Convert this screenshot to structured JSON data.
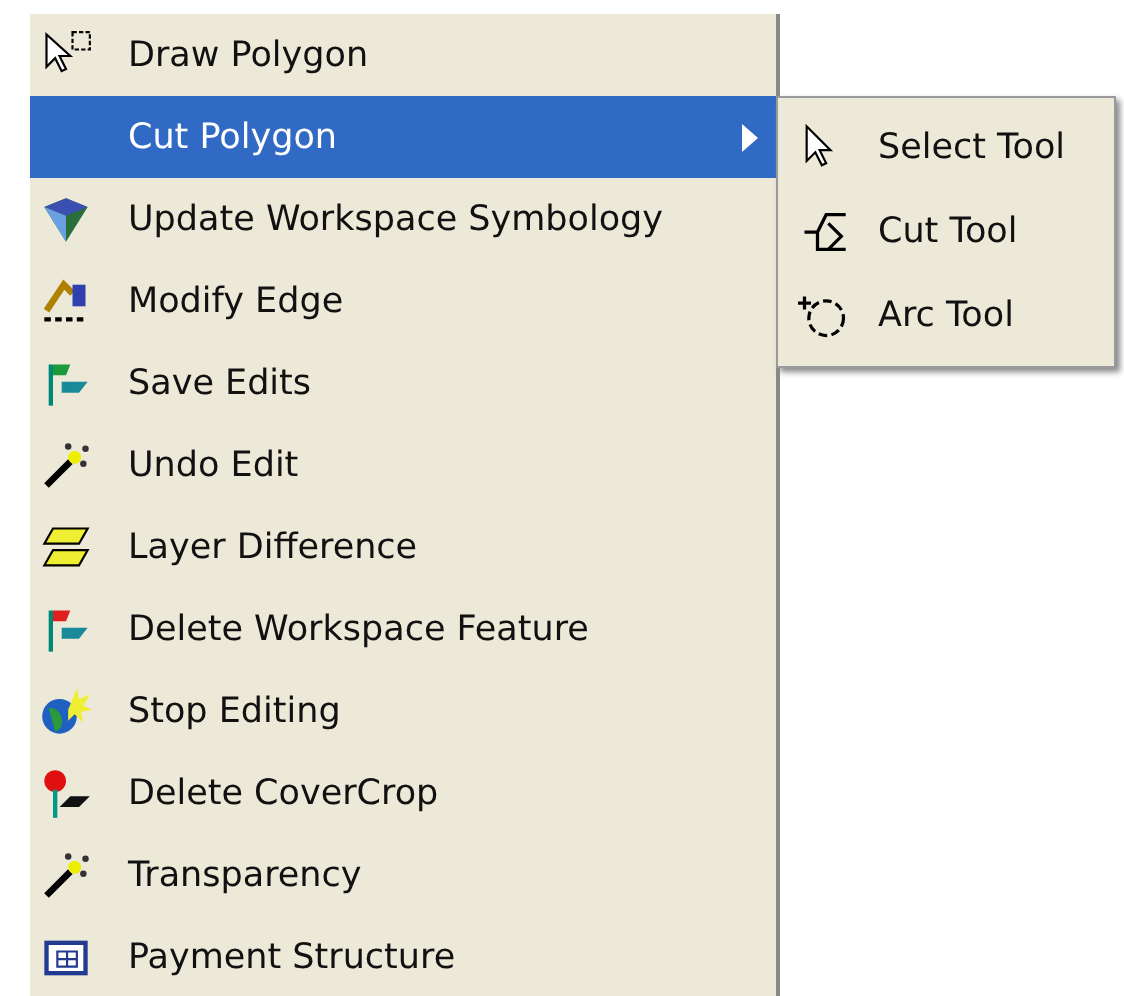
{
  "menu": {
    "items": [
      {
        "label": "Draw Polygon",
        "selected": false
      },
      {
        "label": "Cut Polygon",
        "selected": true,
        "submenu": {
          "items": [
            {
              "label": "Select Tool"
            },
            {
              "label": "Cut Tool"
            },
            {
              "label": "Arc Tool"
            }
          ]
        }
      },
      {
        "label": "Update Workspace Symbology",
        "selected": false
      },
      {
        "label": "Modify Edge",
        "selected": false
      },
      {
        "label": "Save Edits",
        "selected": false
      },
      {
        "label": "Undo Edit",
        "selected": false
      },
      {
        "label": "Layer Difference",
        "selected": false
      },
      {
        "label": "Delete Workspace Feature",
        "selected": false
      },
      {
        "label": "Stop Editing",
        "selected": false
      },
      {
        "label": "Delete CoverCrop",
        "selected": false
      },
      {
        "label": "Transparency",
        "selected": false
      },
      {
        "label": "Payment Structure",
        "selected": false
      }
    ]
  }
}
